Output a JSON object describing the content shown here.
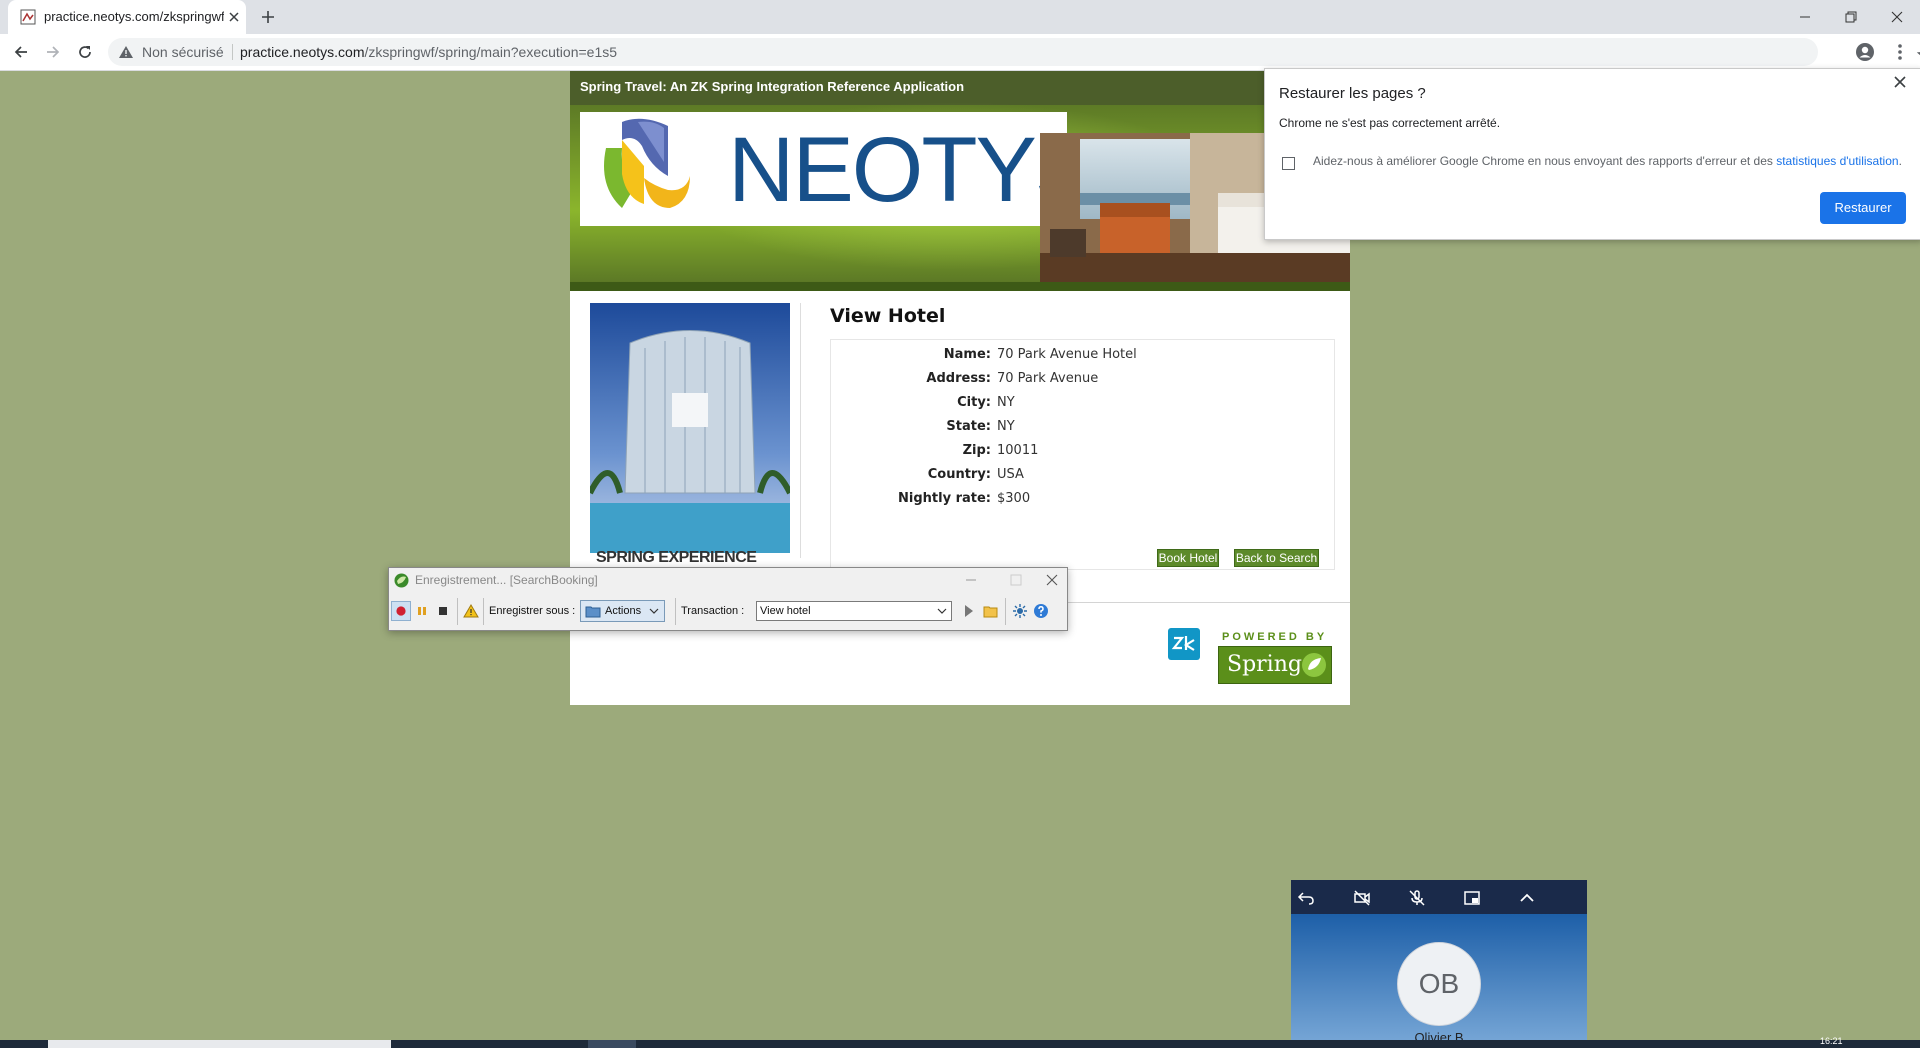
{
  "browser": {
    "tab_title": "practice.neotys.com/zkspringwf/",
    "security_label": "Non sécurisé",
    "url_host": "practice.neotys.com",
    "url_path": "/zkspringwf/spring/main?execution=e1s5"
  },
  "page": {
    "app_title": "Spring Travel: An ZK Spring Integration Reference Application",
    "logo_text": "NEOTYS",
    "photo_caption": "SPRING EXPERIENCE",
    "heading": "View Hotel",
    "fields": [
      {
        "label": "Name:",
        "value": "70 Park Avenue Hotel"
      },
      {
        "label": "Address:",
        "value": "70 Park Avenue"
      },
      {
        "label": "City:",
        "value": "NY"
      },
      {
        "label": "State:",
        "value": "NY"
      },
      {
        "label": "Zip:",
        "value": "10011"
      },
      {
        "label": "Country:",
        "value": "USA"
      },
      {
        "label": "Nightly rate:",
        "value": "$300"
      }
    ],
    "book_button": "Book Hotel",
    "back_button": "Back to Search",
    "powered_by": "POWERED BY",
    "spring_logo": "Spring"
  },
  "restore_dialog": {
    "title": "Restaurer les pages ?",
    "message": "Chrome ne s'est pas correctement arrêté.",
    "checkbox_text": "Aidez-nous à améliorer Google Chrome en nous envoyant des rapports d'erreur et des ",
    "checkbox_link": "statistiques d'utilisation",
    "checkbox_end": ".",
    "button": "Restaurer"
  },
  "recorder": {
    "title": "Enregistrement... [SearchBooking]",
    "save_under_label": "Enregistrer sous :",
    "actions_label": "Actions",
    "transaction_label": "Transaction :",
    "transaction_value": "View hotel"
  },
  "meet": {
    "initials": "OB",
    "name": "Olivier B"
  },
  "taskbar": {
    "clock": "16:21"
  },
  "colors": {
    "desktop": "#9caa7b",
    "header_green": "#5d7a26",
    "chrome_blue": "#1a73e8",
    "neotys_blue": "#17508a"
  }
}
